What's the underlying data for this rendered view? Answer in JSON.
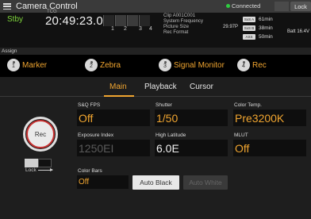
{
  "title_bar": {
    "title": "Camera Control",
    "connection_status": "Connected",
    "lock_label": "Lock",
    "colors": {
      "connected": "#2ecc40"
    }
  },
  "status": {
    "rec_state": "Stby",
    "tc_label": "TCG",
    "timecode": "20:49:23.04",
    "meter_numbers": [
      "1",
      "2",
      "3",
      "4"
    ],
    "clip_label": "Clip",
    "clip_name": "A001C001",
    "system_frequency_label": "System Frequency",
    "system_frequency_value": "29.97P",
    "picture_size_label": "Picture Size",
    "rec_format_label": "Rec Format",
    "media": [
      {
        "tag": "SxS A",
        "remaining": "61min"
      },
      {
        "tag": "SxS B",
        "remaining": "38min"
      },
      {
        "tag": "AXS",
        "remaining": "50min"
      }
    ],
    "battery": "Batt  16.4V",
    "colors": {
      "stby": "#7fd63c"
    }
  },
  "assign": {
    "label": "Assign",
    "items": [
      {
        "num": "1",
        "label": "Marker"
      },
      {
        "num": "2",
        "label": "Zebra"
      },
      {
        "num": "3",
        "label": "Signal Monitor"
      },
      {
        "num": "4",
        "label": "Rec"
      }
    ],
    "colors": {
      "label": "#f0a530"
    }
  },
  "tabs": [
    {
      "label": "Main",
      "active": true
    },
    {
      "label": "Playback",
      "active": false
    },
    {
      "label": "Cursor",
      "active": false
    }
  ],
  "rec_button": {
    "label": "Rec",
    "lock_label": "Lock"
  },
  "params": {
    "sq_fps": {
      "label": "S&Q FPS",
      "value": "Off"
    },
    "shutter": {
      "label": "Shutter",
      "value": "1/50"
    },
    "color_temp": {
      "label": "Color Temp.",
      "value": "Pre3200K"
    },
    "exposure_index": {
      "label": "Exposure Index",
      "value": "1250EI"
    },
    "high_latitude": {
      "label": "High Latitude",
      "value": "6.0E"
    },
    "mlut": {
      "label": "MLUT",
      "value": "Off"
    },
    "color_bars": {
      "label": "Color Bars",
      "value": "Off"
    }
  },
  "buttons": {
    "auto_black": "Auto Black",
    "auto_white": "Auto White"
  }
}
